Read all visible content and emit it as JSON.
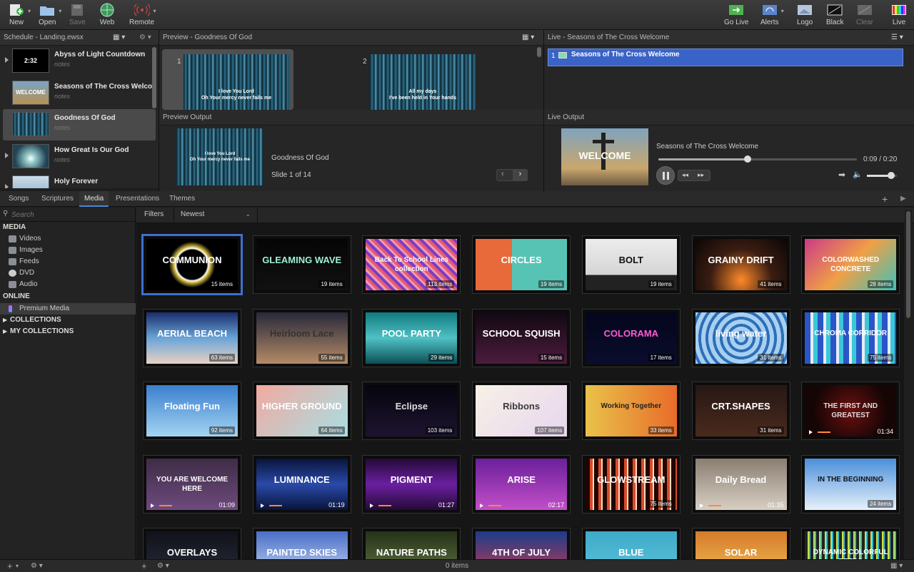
{
  "toolbar": {
    "new": "New",
    "open": "Open",
    "save": "Save",
    "web": "Web",
    "remote": "Remote",
    "go_live": "Go Live",
    "alerts": "Alerts",
    "logo": "Logo",
    "black": "Black",
    "clear": "Clear",
    "live": "Live"
  },
  "schedule": {
    "title": "Schedule - Landing.ewsx",
    "items": [
      {
        "title": "Abyss of Light Countdown",
        "notes": "notes",
        "thumb": "2:32"
      },
      {
        "title": "Seasons of The Cross Welcome",
        "notes": "notes",
        "thumb": "WELCOME"
      },
      {
        "title": "Goodness Of God",
        "notes": "notes",
        "thumb": ""
      },
      {
        "title": "How Great Is Our God",
        "notes": "notes",
        "thumb": ""
      },
      {
        "title": "Holy Forever",
        "notes": "",
        "thumb": ""
      }
    ]
  },
  "preview": {
    "title": "Preview - Goodness Of God",
    "slides": [
      {
        "num": "1",
        "line1": "I love You Lord",
        "line2": "Oh Your mercy never fails me"
      },
      {
        "num": "2",
        "line1": "All my days",
        "line2": "I've been held in Your hands"
      }
    ]
  },
  "live": {
    "title": "Live - Seasons of The Cross Welcome",
    "item_num": "1",
    "item_title": "Seasons of The Cross Welcome"
  },
  "preview_output": {
    "title": "Preview Output",
    "song": "Goodness Of God",
    "slide_info": "Slide 1 of 14",
    "line1": "I love You Lord",
    "line2": "Oh Your mercy never fails me"
  },
  "live_output": {
    "title": "Live Output",
    "name": "Seasons of The Cross Welcome",
    "time": "0:09 / 0:20",
    "progress": 0.45,
    "volume": 0.8,
    "thumb_text": "WELCOME"
  },
  "tabs": [
    "Songs",
    "Scriptures",
    "Media",
    "Presentations",
    "Themes"
  ],
  "search": {
    "placeholder": "Search"
  },
  "filters": {
    "label": "Filters",
    "sort": "Newest"
  },
  "sidebar": {
    "media_header": "MEDIA",
    "media": [
      "Videos",
      "Images",
      "Feeds",
      "DVD",
      "Audio"
    ],
    "online_header": "ONLINE",
    "online": [
      "Premium Media"
    ],
    "collections": "COLLECTIONS",
    "my_collections": "MY COLLECTIONS"
  },
  "status": {
    "count": "0 items"
  },
  "cards": [
    {
      "t": "COMMUNION",
      "c": "15 items"
    },
    {
      "t": "GLEAMING WAVE",
      "c": "19 items"
    },
    {
      "t": "Back To School Lines collection",
      "c": "113 items"
    },
    {
      "t": "CIRCLES",
      "c": "19 items"
    },
    {
      "t": "BOLT",
      "c": "19 items"
    },
    {
      "t": "GRAINY DRIFT",
      "c": "41 items"
    },
    {
      "t": "COLORWASHED CONCRETE",
      "c": "28 items"
    },
    {
      "t": "AERIAL BEACH",
      "c": "63 items"
    },
    {
      "t": "Heirloom Lace",
      "c": "55 items"
    },
    {
      "t": "POOL PARTY",
      "c": "29 items"
    },
    {
      "t": "SCHOOL SQUISH",
      "c": "15 items"
    },
    {
      "t": "COLORAMA",
      "c": "17 items"
    },
    {
      "t": "living water",
      "c": "31 items"
    },
    {
      "t": "CHROMA CORRIDOR",
      "c": "75 items"
    },
    {
      "t": "Floating Fun",
      "c": "92 items"
    },
    {
      "t": "HIGHER GROUND",
      "c": "64 items"
    },
    {
      "t": "Eclipse",
      "c": "103 items"
    },
    {
      "t": "Ribbons",
      "c": "107 items"
    },
    {
      "t": "Working Together",
      "c": "33 items"
    },
    {
      "t": "CRT.SHAPES",
      "c": "31 items"
    },
    {
      "t": "THE FIRST AND GREATEST",
      "d": "01:34"
    },
    {
      "t": "YOU ARE WELCOME HERE",
      "d": "01:09"
    },
    {
      "t": "LUMINANCE",
      "d": "01:19"
    },
    {
      "t": "PIGMENT",
      "d": "01:27"
    },
    {
      "t": "ARISE",
      "d": "02:17"
    },
    {
      "t": "GLOWSTREAM",
      "c": "75 items"
    },
    {
      "t": "Daily Bread",
      "d": "01:35"
    },
    {
      "t": "IN THE BEGINNING",
      "c": "24 items"
    },
    {
      "t": "OVERLAYS",
      "c": ""
    },
    {
      "t": "PAINTED SKIES",
      "c": ""
    },
    {
      "t": "NATURE PATHS",
      "c": ""
    },
    {
      "t": "4TH OF JULY",
      "c": ""
    },
    {
      "t": "BLUE",
      "c": ""
    },
    {
      "t": "SOLAR",
      "c": ""
    },
    {
      "t": "DYNAMIC COLORFUL RETRO",
      "c": ""
    }
  ],
  "colors": {
    "accent": "#3e6fd1",
    "live_highlight": "#3a63c8"
  }
}
